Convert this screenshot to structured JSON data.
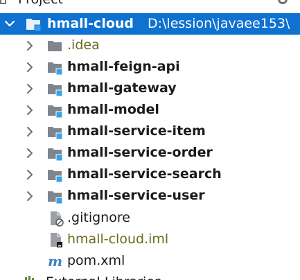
{
  "panel": {
    "title": "Project"
  },
  "tree": {
    "root": {
      "name": "hmall-cloud",
      "path": "D:\\lession\\javaee153\\"
    },
    "children": [
      {
        "name": ".idea",
        "type": "folder",
        "expandable": true
      },
      {
        "name": "hmall-feign-api",
        "type": "module",
        "expandable": true
      },
      {
        "name": "hmall-gateway",
        "type": "module",
        "expandable": true
      },
      {
        "name": "hmall-model",
        "type": "module",
        "expandable": true
      },
      {
        "name": "hmall-service-item",
        "type": "module",
        "expandable": true
      },
      {
        "name": "hmall-service-order",
        "type": "module",
        "expandable": true
      },
      {
        "name": "hmall-service-search",
        "type": "module",
        "expandable": true
      },
      {
        "name": "hmall-service-user",
        "type": "module",
        "expandable": true
      },
      {
        "name": ".gitignore",
        "type": "ignored-file",
        "expandable": false
      },
      {
        "name": "hmall-cloud.iml",
        "type": "iml-file",
        "expandable": false
      },
      {
        "name": "pom.xml",
        "type": "maven-file",
        "expandable": false
      }
    ],
    "next_root": {
      "name": "External Libraries"
    }
  },
  "colors": {
    "selection": "#0f72d0",
    "module_badge": "#3aa0e8",
    "folder": "#7f858c",
    "olive_text": "#6d6a1a",
    "maven": "#3b82c4"
  },
  "icons": {
    "expand": "chevron-right-icon",
    "collapse": "chevron-down-icon",
    "folder": "folder-icon",
    "module": "module-folder-icon",
    "ignore": "gitignore-file-icon",
    "iml": "iml-file-icon",
    "maven": "maven-icon"
  }
}
